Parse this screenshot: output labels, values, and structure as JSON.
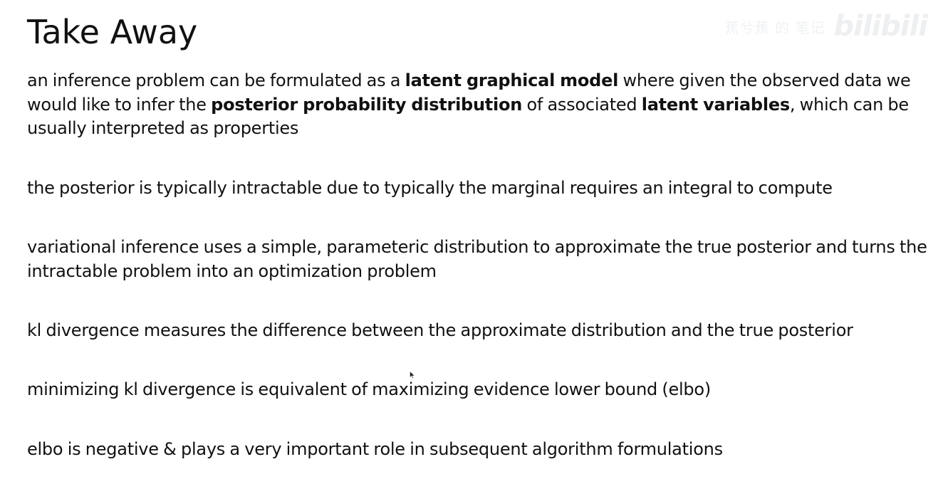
{
  "slide": {
    "title": "Take Away",
    "bullets": [
      {
        "segments": [
          {
            "text": "an inference problem can be formulated as a ",
            "bold": false
          },
          {
            "text": "latent graphical model",
            "bold": true
          },
          {
            "text": " where given the observed data we would like to infer the ",
            "bold": false
          },
          {
            "text": "posterior probability distribution",
            "bold": true
          },
          {
            "text": " of associated ",
            "bold": false
          },
          {
            "text": "latent variables",
            "bold": true
          },
          {
            "text": ", which can be usually interpreted as properties",
            "bold": false
          }
        ]
      },
      {
        "segments": [
          {
            "text": "the posterior is typically intractable due to typically the marginal requires an integral to compute",
            "bold": false
          }
        ]
      },
      {
        "segments": [
          {
            "text": "variational inference uses a simple, parameteric distribution to approximate the true posterior and turns the intractable problem into an optimization problem",
            "bold": false
          }
        ]
      },
      {
        "segments": [
          {
            "text": "kl divergence measures the difference between the approximate distribution and the true posterior",
            "bold": false
          }
        ]
      },
      {
        "segments": [
          {
            "text": "minimizing kl divergence is equivalent of maximizing evidence lower bound (elbo)",
            "bold": false
          }
        ]
      },
      {
        "segments": [
          {
            "text": "elbo is negative & plays a very important role in subsequent algorithm formulations",
            "bold": false
          }
        ]
      }
    ]
  },
  "watermark": {
    "text": "蕉兮蕉 的 笔记",
    "logo": "bilibili"
  },
  "colors": {
    "text": "#111111",
    "background": "#ffffff",
    "watermark": "#eceef0"
  }
}
